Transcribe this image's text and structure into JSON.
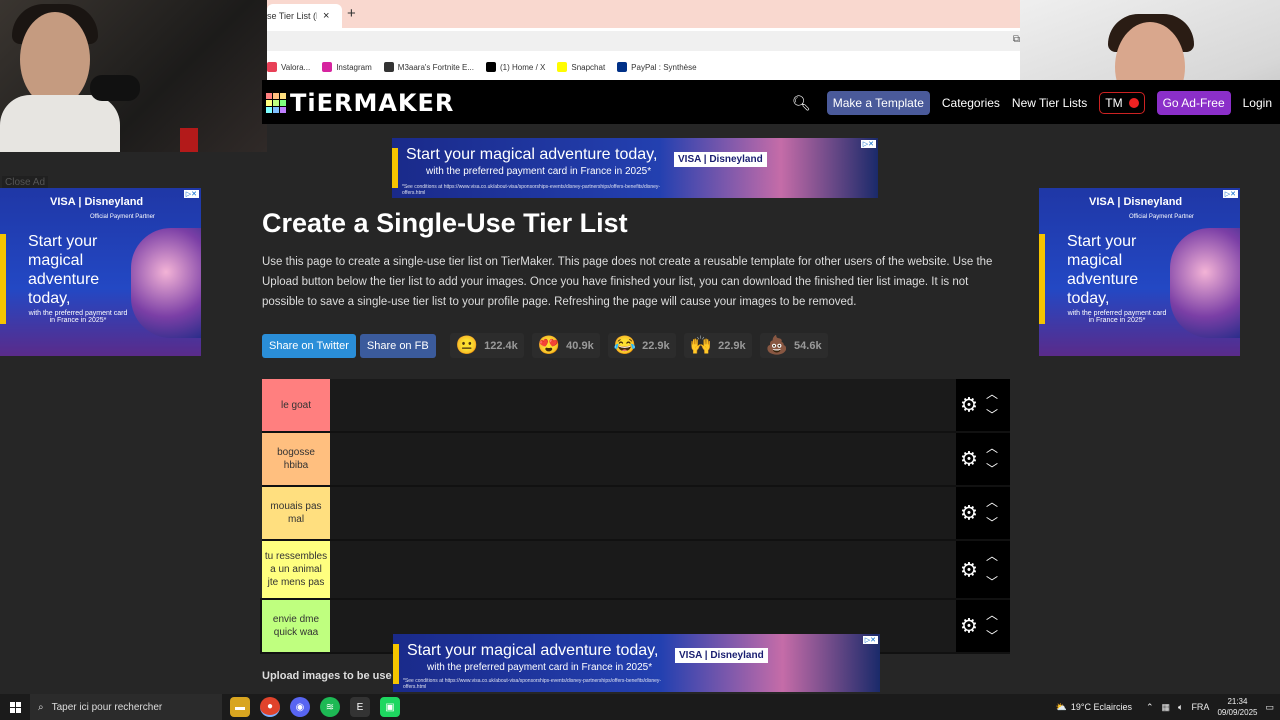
{
  "browser": {
    "tab_title": "se Tier List (Pl",
    "tab_close": "×",
    "new_tab": "+",
    "bookmarks": [
      {
        "label": "Valora...",
        "icon": "valorant-icon",
        "color": "#e84057"
      },
      {
        "label": "Instagram",
        "icon": "instagram-icon",
        "color": "#d6249f"
      },
      {
        "label": "M3aara's Fortnite E...",
        "icon": "fortnite-icon",
        "color": "#333333"
      },
      {
        "label": "(1) Home / X",
        "icon": "x-icon",
        "color": "#000000"
      },
      {
        "label": "Snapchat",
        "icon": "snapchat-icon",
        "color": "#fffc00"
      },
      {
        "label": "PayPal : Synthèse",
        "icon": "paypal-icon",
        "color": "#003087"
      }
    ]
  },
  "nav": {
    "logo": "TiERMAKER",
    "make_template": "Make a Template",
    "categories": "Categories",
    "new_tier_lists": "New Tier Lists",
    "tm": "TM",
    "go_ad_free": "Go Ad-Free",
    "login": "Login"
  },
  "ads": {
    "banner_head": "Start your magical adventure today,",
    "banner_sub": "with the preferred payment card in France in 2025*",
    "banner_small": "*See conditions at https://www.visa.co.uk/about-visa/sponsorships-events/disney-partnerships/offers-benefits/disney-offers.html",
    "brand": "VISA | Disneyland",
    "partner": "Official Payment Partner",
    "side_head": "Start your magical adventure today,",
    "side_sub": "with the preferred payment card in France in 2025*",
    "close_ad": "Close Ad"
  },
  "page": {
    "title": "Create a Single-Use Tier List",
    "description": "Use this page to create a single-use tier list on TierMaker. This page does not create a reusable template for other users of the website. Use the Upload button below the tier list to add your images. Once you have finished your list, you can download the finished tier list image. It is not possible to save a single-use tier list to your profile page. Refreshing the page will cause your images to be removed.",
    "share_twitter": "Share on Twitter",
    "share_fb": "Share on FB",
    "reactions": [
      {
        "emoji": "😐",
        "count": "122.4k",
        "name": "neutral-face-icon"
      },
      {
        "emoji": "😍",
        "count": "40.9k",
        "name": "heart-eyes-icon"
      },
      {
        "emoji": "😂",
        "count": "22.9k",
        "name": "laughing-icon"
      },
      {
        "emoji": "🙌",
        "count": "22.9k",
        "name": "raised-hands-icon"
      },
      {
        "emoji": "💩",
        "count": "54.6k",
        "name": "poop-icon"
      }
    ],
    "upload_text": "Upload images to be use"
  },
  "tiers": [
    {
      "label": "le goat",
      "color": "#ff7f7f"
    },
    {
      "label": "bogosse hbiba",
      "color": "#ffbf7f"
    },
    {
      "label": "mouais pas mal",
      "color": "#ffdf7f"
    },
    {
      "label": "tu ressembles a un animal jte mens pas",
      "color": "#ffff7f"
    },
    {
      "label": "envie dme quick waa",
      "color": "#bfff7f"
    }
  ],
  "taskbar": {
    "search_placeholder": "Taper ici pour rechercher",
    "weather": "19°C  Eclaircies",
    "lang": "FRA",
    "time": "21:34",
    "date": "09/09/2025"
  },
  "colors": {
    "accent_blue": "#4a5a9a",
    "accent_purple": "#8b2fc9",
    "twitter": "#2a8ed8",
    "facebook": "#3b5b9c"
  }
}
